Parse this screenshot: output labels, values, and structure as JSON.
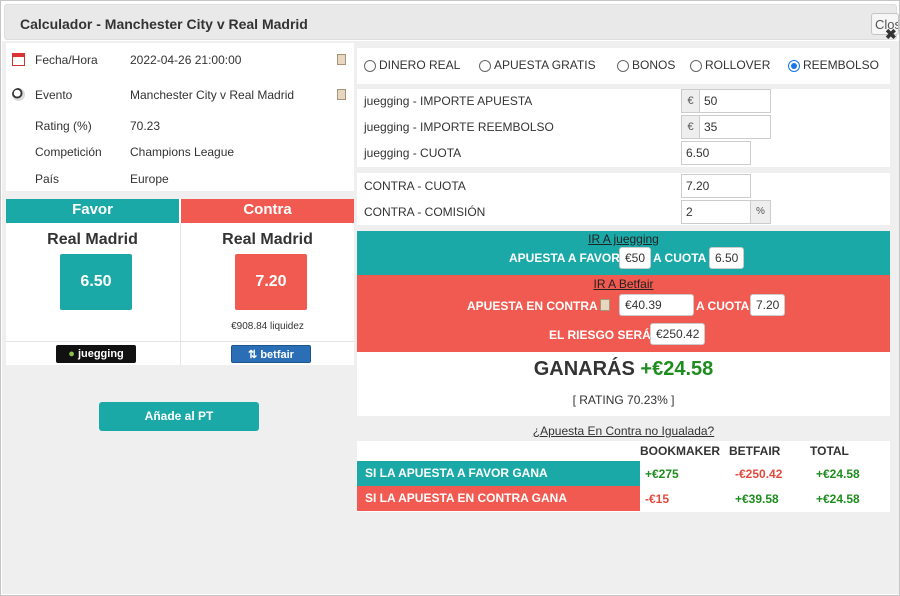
{
  "dialog": {
    "title": "Calculador - Manchester City v Real Madrid",
    "close_label": "Close"
  },
  "info": {
    "rows": [
      {
        "label": "Fecha/Hora",
        "value": "2022-04-26 21:00:00"
      },
      {
        "label": "Evento",
        "value": "Manchester City v Real Madrid"
      },
      {
        "label": "Rating (%)",
        "value": "70.23"
      },
      {
        "label": "Competición",
        "value": "Champions League"
      },
      {
        "label": "País",
        "value": "Europe"
      }
    ]
  },
  "favor": {
    "header": "Favor",
    "team": "Real Madrid",
    "odds": "6.50",
    "bookmaker": "juegging"
  },
  "contra": {
    "header": "Contra",
    "team": "Real Madrid",
    "odds": "7.20",
    "liquidity": "€908.84 liquidez",
    "exchange": "betfair"
  },
  "add_button": "Añade al PT",
  "bet_types": [
    {
      "label": "DINERO REAL",
      "selected": false
    },
    {
      "label": "APUESTA GRATIS",
      "selected": false
    },
    {
      "label": "BONOS",
      "selected": false
    },
    {
      "label": "ROLLOVER",
      "selected": false
    },
    {
      "label": "REEMBOLSO",
      "selected": true
    }
  ],
  "bookie_fields": {
    "stake_label": "juegging - IMPORTE APUESTA",
    "stake_value": "50",
    "currency": "€",
    "refund_label": "juegging - IMPORTE REEMBOLSO",
    "refund_value": "35",
    "odds_label": "juegging - CUOTA",
    "odds_value": "6.50"
  },
  "lay_fields": {
    "odds_label": "CONTRA - CUOTA",
    "odds_value": "7.20",
    "commission_label": "CONTRA - COMISIÓN",
    "commission_value": "2",
    "percent": "%"
  },
  "back_band": {
    "link": "IR A juegging",
    "text1": "APUESTA A FAVOR",
    "stake": "€50",
    "text2": "A CUOTA",
    "odds": "6.50"
  },
  "lay_band": {
    "link": "IR A Betfair",
    "text1": "APUESTA EN CONTRA",
    "stake": "€40.39",
    "text2": "A CUOTA",
    "odds": "7.20",
    "risk_label": "EL RIESGO SERÁ",
    "risk": "€250.42"
  },
  "result": {
    "label": "GANARÁS",
    "amount": "+€24.58",
    "rating": "[ RATING 70.23% ]"
  },
  "unmatched_link": "¿Apuesta En Contra no Igualada?",
  "outcomes": {
    "headers": [
      "BOOKMAKER",
      "BETFAIR",
      "TOTAL"
    ],
    "rows": [
      {
        "label": "SI LA APUESTA A FAVOR GANA",
        "bookmaker": "+€275",
        "betfair": "-€250.42",
        "total": "+€24.58"
      },
      {
        "label": "SI LA APUESTA EN CONTRA GANA",
        "bookmaker": "-€15",
        "betfair": "+€39.58",
        "total": "+€24.58"
      }
    ]
  },
  "colors": {
    "teal": "#1aa9a7",
    "red": "#f05a50",
    "profit_green": "#1e8c1e"
  }
}
